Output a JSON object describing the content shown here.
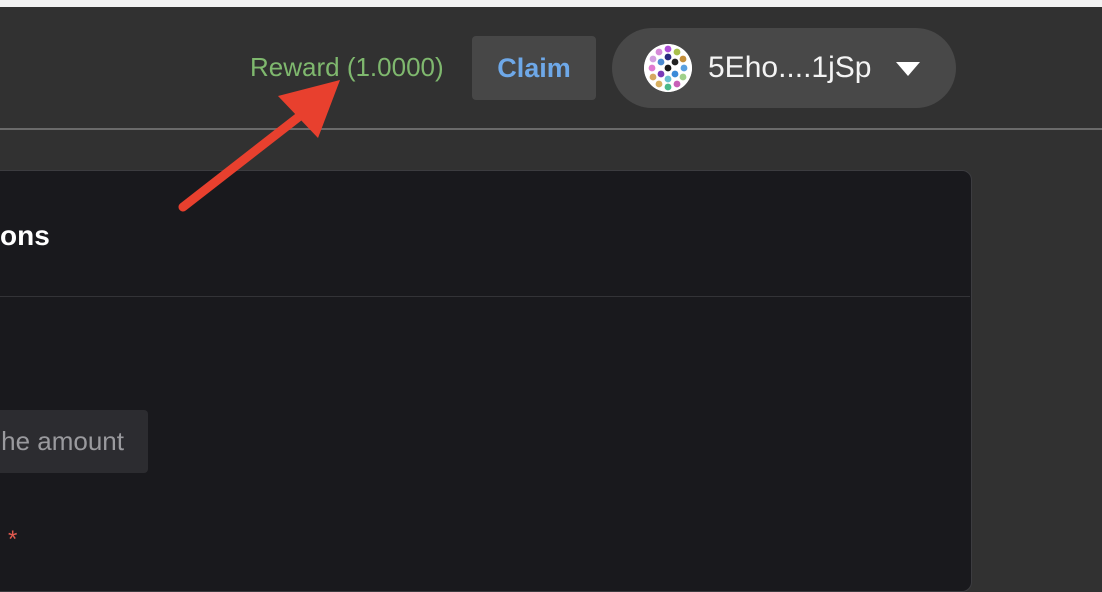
{
  "header": {
    "reward_label": "Reward (1.0000)",
    "claim_label": "Claim",
    "account": {
      "address": "5Eho....1jSp",
      "avatar": "identicon-avatar",
      "dropdown_icon": "caret-down-icon"
    }
  },
  "panel": {
    "title": "ons",
    "amount_placeholder": "he amount",
    "required_marker": "*"
  },
  "colors": {
    "reward_text": "#7fb86e",
    "claim_text": "#6ea8e8",
    "annotation_arrow": "#e8402e",
    "required_marker": "#e05a4f"
  }
}
